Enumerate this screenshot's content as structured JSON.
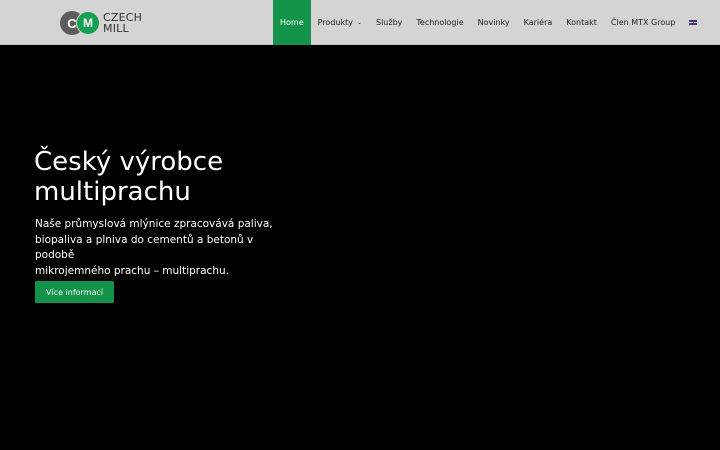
{
  "header": {
    "logo": {
      "mark_c": "C",
      "mark_m": "M",
      "line1": "CZECH",
      "line2": "MILL"
    },
    "nav": [
      {
        "label": "Home",
        "active": true
      },
      {
        "label": "Produkty",
        "has_dropdown": true
      },
      {
        "label": "Služby"
      },
      {
        "label": "Technologie"
      },
      {
        "label": "Novinky"
      },
      {
        "label": "Kariéra"
      },
      {
        "label": "Kontakt"
      },
      {
        "label": "Člen MTX Group"
      }
    ],
    "language_flag": "uk-flag-icon"
  },
  "hero": {
    "title_line1": "Český výrobce",
    "title_line2": "multiprachu",
    "text_line1": "Naše průmyslová mlýnice zpracovává paliva,",
    "text_line2": "biopaliva a plniva do cementů a betonů v podobě",
    "text_line3": "mikrojemného prachu – multiprachu.",
    "cta_label": "Více informací"
  },
  "colors": {
    "accent": "#13924a",
    "header_bg": "#d4d4d4",
    "hero_bg": "#000000"
  }
}
